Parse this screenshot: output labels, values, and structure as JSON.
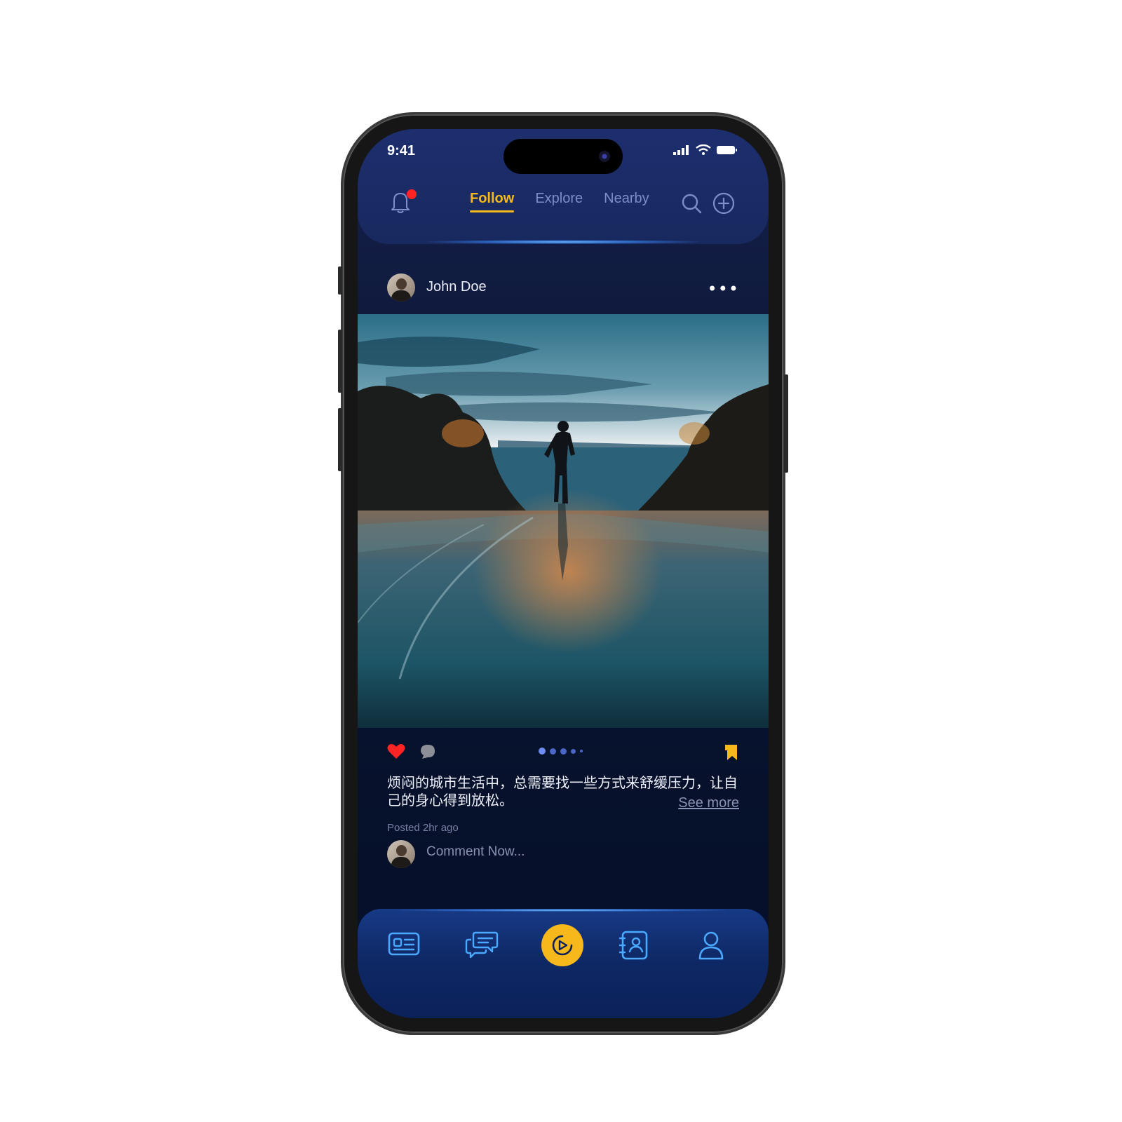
{
  "status_bar": {
    "time": "9:41"
  },
  "header": {
    "tabs": [
      {
        "label": "Follow",
        "active": true
      },
      {
        "label": "Explore",
        "active": false
      },
      {
        "label": "Nearby",
        "active": false
      }
    ],
    "notification_badge": true
  },
  "post": {
    "username": "John Doe",
    "more_label": "•••",
    "liked": true,
    "carousel": {
      "total": 5,
      "active_index": 0
    },
    "caption": "烦闷的城市生活中，总需要找一些方式来舒缓压力，让自己的身心得到放松。",
    "see_more": "See more",
    "posted": "Posted 2hr ago",
    "comment_placeholder": "Comment Now..."
  },
  "bottom_nav": {
    "items": [
      "news-icon",
      "chat-icon",
      "play-icon",
      "contacts-icon",
      "profile-icon"
    ],
    "active": "play-icon"
  },
  "colors": {
    "accent": "#f6b81b",
    "header": "#1d2e6e",
    "background": "#06102a",
    "like": "#ff2424",
    "tab_inactive": "#7e8fc7"
  }
}
